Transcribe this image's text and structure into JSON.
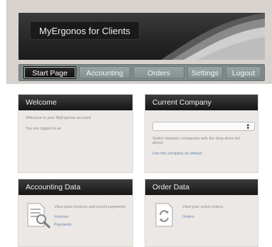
{
  "app": {
    "title": "MyErgonos for Clients"
  },
  "nav": {
    "items": [
      {
        "label": "Start Page",
        "active": true
      },
      {
        "label": "Accounting",
        "active": false
      },
      {
        "label": "Orders",
        "active": false
      },
      {
        "label": "Settings",
        "active": false
      },
      {
        "label": "Logout",
        "active": false
      }
    ]
  },
  "welcome": {
    "title": "Welcome",
    "line1": "Welcome to your MyErgonos account.",
    "line2": "You are logged in as"
  },
  "company": {
    "title": "Current Company",
    "select_value": "",
    "help": "Switch between companies with the drop-down list above.",
    "default_link": "Use this company as default."
  },
  "accounting": {
    "title": "Accounting Data",
    "desc": "View open invoices and recent payments",
    "links": [
      "Invoices",
      "Payments"
    ]
  },
  "orders": {
    "title": "Order Data",
    "desc": "View your active orders.",
    "links": [
      "Orders"
    ]
  },
  "colors": {
    "header_bg": "#1f1f1f",
    "nav_bg": "#7f8a8a",
    "panel_bg": "#ece8e5",
    "link": "#6a86a8"
  }
}
